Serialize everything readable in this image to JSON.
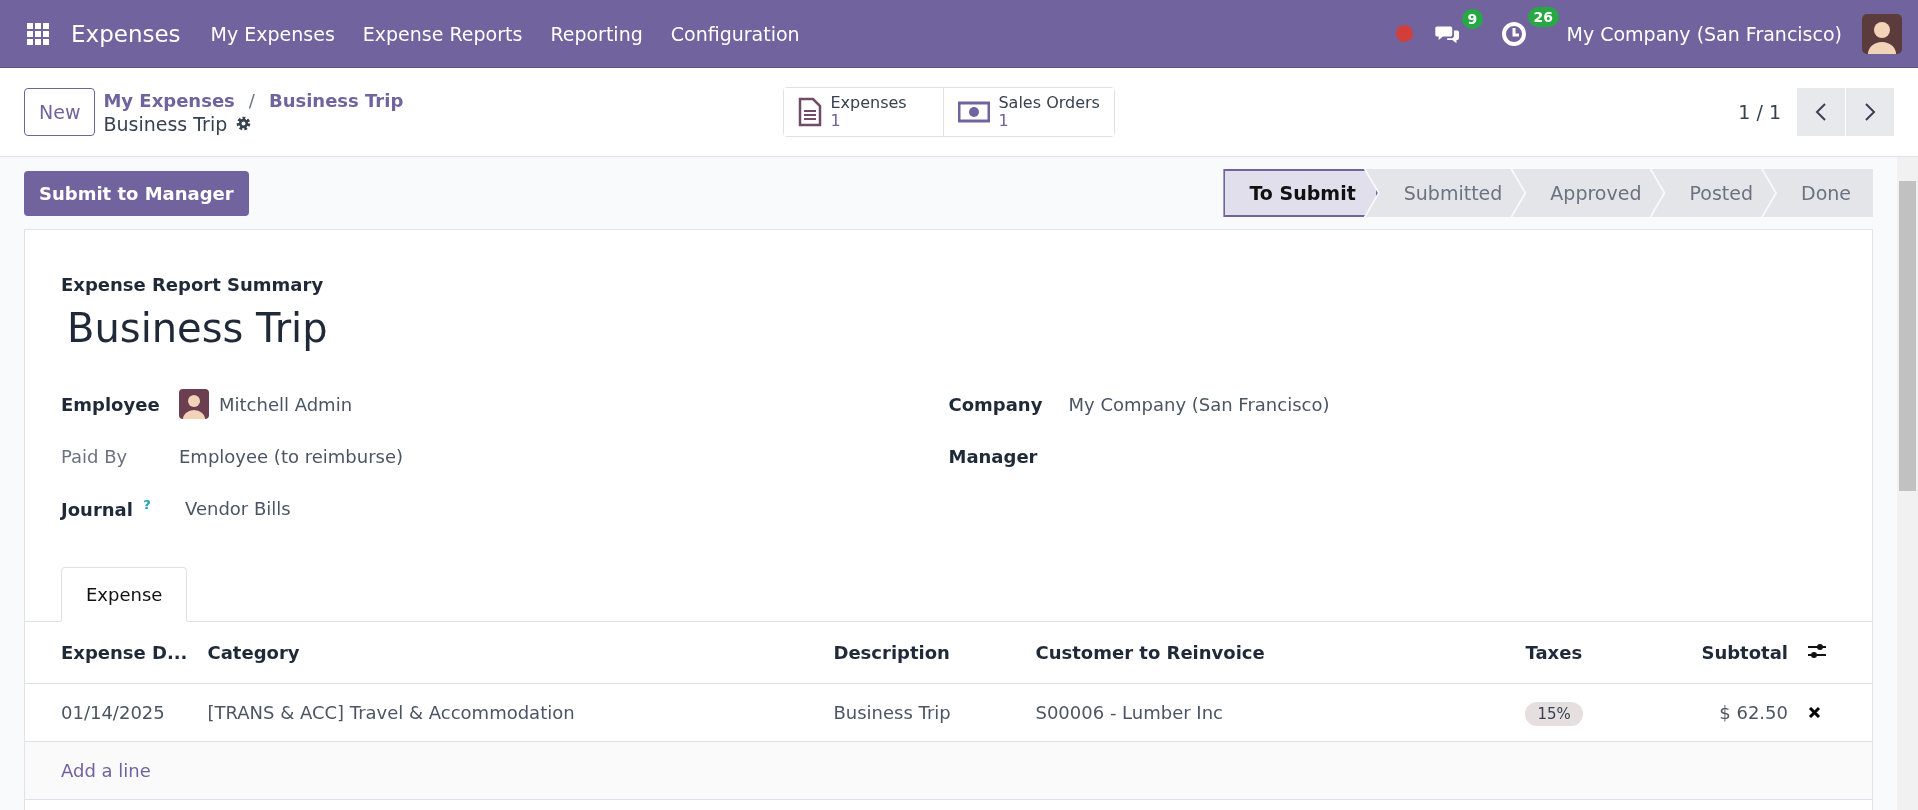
{
  "navbar": {
    "app_name": "Expenses",
    "menu": [
      "My Expenses",
      "Expense Reports",
      "Reporting",
      "Configuration"
    ],
    "messages_count": "9",
    "activities_count": "26",
    "company": "My Company (San Francisco)"
  },
  "control_panel": {
    "new_button": "New",
    "breadcrumb": [
      "My Expenses",
      "Business Trip"
    ],
    "breadcrumb_separator": "/",
    "current": "Business Trip",
    "smart_buttons": [
      {
        "kind": "document",
        "label": "Expenses",
        "value": "1"
      },
      {
        "kind": "money",
        "label": "Sales Orders",
        "value": "1"
      }
    ],
    "pager": "1 / 1"
  },
  "action_button": "Submit to Manager",
  "status_steps": [
    {
      "label": "To Submit",
      "selected": true
    },
    {
      "label": "Submitted",
      "selected": false
    },
    {
      "label": "Approved",
      "selected": false
    },
    {
      "label": "Posted",
      "selected": false
    },
    {
      "label": "Done",
      "selected": false
    }
  ],
  "form": {
    "subtitle": "Expense Report Summary",
    "title": "Business Trip",
    "left_fields": [
      {
        "label": "Employee",
        "value": "Mitchell Admin",
        "kind": "avatar",
        "bold": true
      },
      {
        "label": "Paid By",
        "value": "Employee (to reimburse)",
        "kind": "text",
        "bold": false
      },
      {
        "label": "Journal",
        "value": "Vendor Bills",
        "kind": "help",
        "bold": true,
        "help": "?"
      }
    ],
    "right_fields": [
      {
        "label": "Company",
        "value": "My Company (San Francisco)",
        "bold": true
      },
      {
        "label": "Manager",
        "bold": true
      }
    ]
  },
  "tabs": [
    {
      "label": "Expense",
      "selected": true
    }
  ],
  "table": {
    "columns": [
      "Expense D...",
      "Category",
      "Description",
      "Customer to Reinvoice",
      "Taxes",
      "Subtotal"
    ],
    "rows": [
      {
        "date": "01/14/2025",
        "category": "[TRANS & ACC] Travel & Accommodation",
        "description": "Business Trip",
        "customer": "S00006 - Lumber Inc",
        "taxes": "15%",
        "subtotal": "$ 62.50"
      }
    ],
    "add_line": "Add a line"
  }
}
